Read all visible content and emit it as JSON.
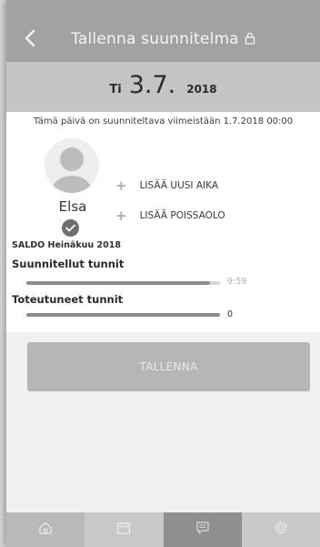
{
  "header": {
    "title": "Tallenna suunnitelma",
    "back_icon": "chevron-left-icon",
    "lock_icon": "lock-icon"
  },
  "date": {
    "weekday": "Ti",
    "day_month": "3.7.",
    "year": "2018"
  },
  "deadline_text": "Tämä päivä on suunniteltava viimeistään 1.7.2018 00:00",
  "person": {
    "name": "Elsa",
    "status_icon": "checkmark-icon"
  },
  "actions": {
    "add_time": "LISÄÄ UUSI AIKA",
    "add_absence": "LISÄÄ POISSAOLO"
  },
  "saldo": {
    "title": "SALDO Heinäkuu 2018",
    "planned_label": "Suunnitellut tunnit",
    "planned_value": "9:59",
    "planned_fill_fraction": 0.95,
    "actual_label": "Toteutuneet tunnit",
    "actual_value": "0",
    "actual_fill_fraction": 1.0
  },
  "save_label": "TALLENNA",
  "nav": {
    "items": [
      "home-icon",
      "calendar-icon",
      "messages-icon",
      "settings-icon"
    ],
    "active": "messages-icon"
  },
  "colors": {
    "topbar": "#a2a2a2",
    "datebar": "#c4c4c4",
    "button": "#b6b6b6",
    "nav_active": "#8f8f8f"
  }
}
